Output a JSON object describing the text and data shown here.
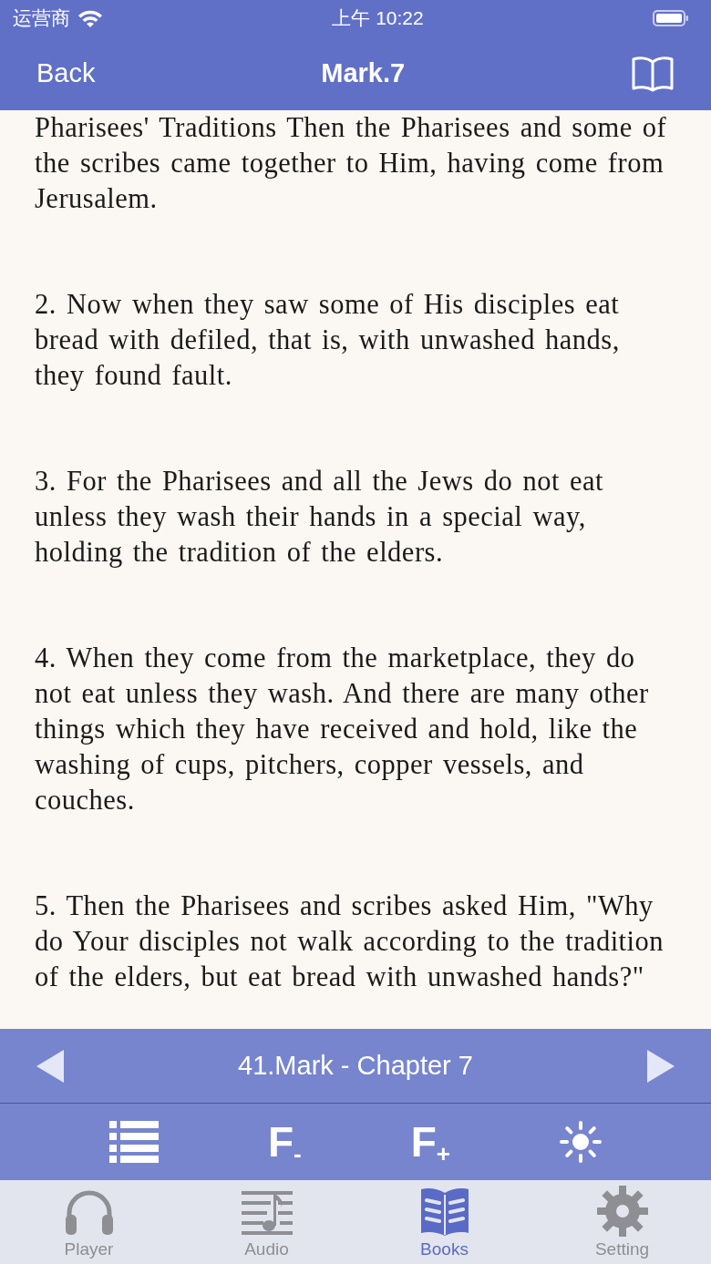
{
  "status_bar": {
    "carrier": "运营商",
    "time": "上午 10:22"
  },
  "nav": {
    "back": "Back",
    "title": "Mark.7"
  },
  "verses": [
    "Pharisees' Traditions Then the Pharisees and some of the scribes came together to Him, having come from Jerusalem.",
    "2. Now when they saw some of His disciples eat bread with defiled, that is, with unwashed hands, they found fault.",
    "3. For the Pharisees and all the Jews do not eat unless they wash their hands in a special way, holding the tradition of the elders.",
    "4. When they come from the marketplace, they do not eat unless they wash. And there are many other things which they have received and hold, like the washing of cups, pitchers, copper vessels, and couches.",
    "5. Then the Pharisees and scribes asked Him, \"Why do Your disciples not walk according to the tradition of the elders, but eat bread with unwashed hands?\""
  ],
  "chapter_bar": {
    "title": "41.Mark - Chapter 7"
  },
  "tools": [
    {
      "kind": "list"
    },
    {
      "kind": "font",
      "label": "F$_{-}$"
    },
    {
      "kind": "font",
      "label": "F$_{+}$"
    },
    {
      "kind": "brightness"
    }
  ],
  "tabs": [
    {
      "label": "Player",
      "kind": "headphones",
      "selected": false
    },
    {
      "label": "Audio",
      "kind": "music",
      "selected": false
    },
    {
      "label": "Books",
      "kind": "book",
      "selected": true
    },
    {
      "label": "Setting",
      "kind": "gear",
      "selected": false
    }
  ]
}
